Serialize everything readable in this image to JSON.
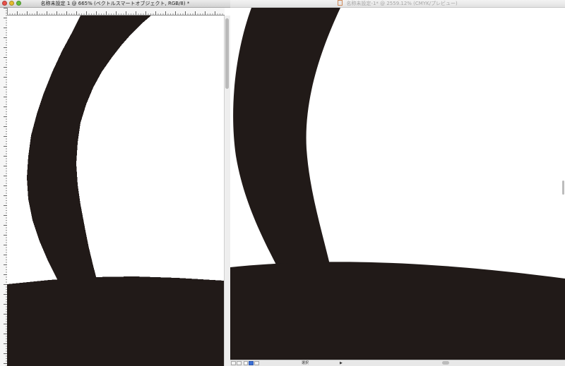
{
  "left_window": {
    "title": "名称未設定 1 @ 665% (ベクトルスマートオブジェクト, RGB/8) *"
  },
  "right_window": {
    "title": "名称未設定-1* @ 2559.12% (CMYK/プレビュー)",
    "status_mode": "選択"
  },
  "colors": {
    "ink": "#211a18",
    "canvas": "#ffffff",
    "chrome": "#d4d4d4"
  }
}
